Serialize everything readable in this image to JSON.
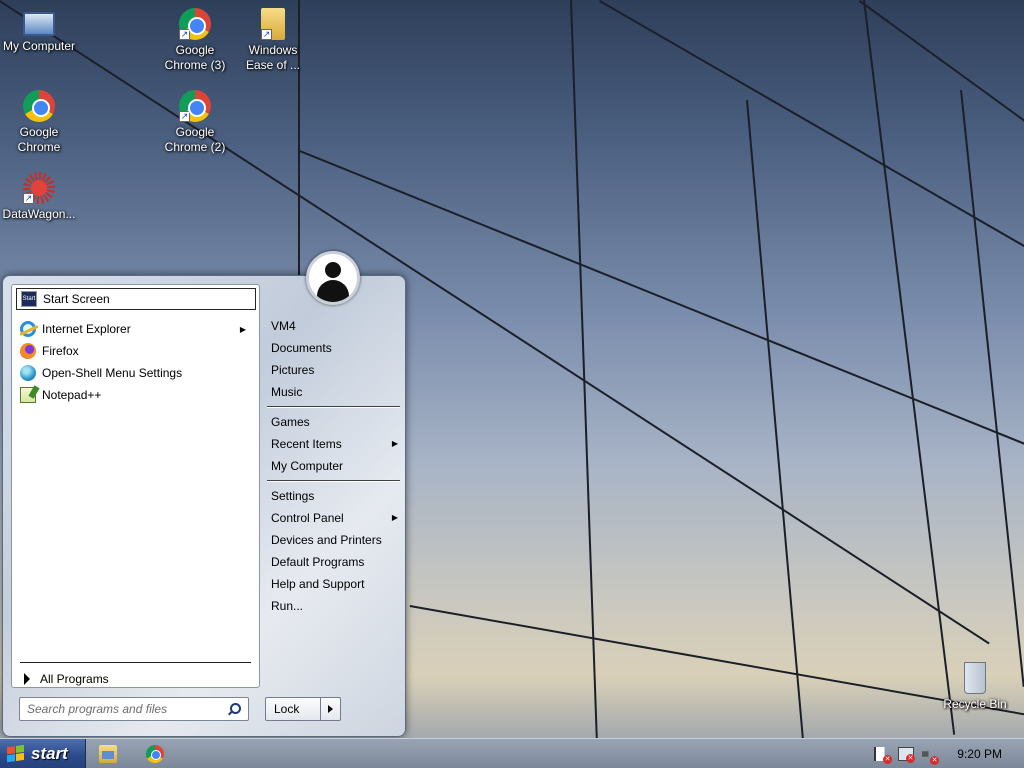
{
  "desktop": {
    "icons": [
      {
        "label_line1": "My Computer",
        "label_line2": "",
        "icon": "computer-icon"
      },
      {
        "label_line1": "Google",
        "label_line2": "Chrome (3)",
        "icon": "chrome-icon"
      },
      {
        "label_line1": "Windows",
        "label_line2": "Ease of ...",
        "icon": "folder-icon"
      },
      {
        "label_line1": "Google",
        "label_line2": "Chrome",
        "icon": "chrome-icon"
      },
      {
        "label_line1": "Google",
        "label_line2": "Chrome (2)",
        "icon": "chrome-icon"
      },
      {
        "label_line1": "DataWagon...",
        "label_line2": "",
        "icon": "datawagon-icon"
      },
      {
        "label_line1": "Recycle Bin",
        "label_line2": "",
        "icon": "recycle-bin-icon"
      }
    ]
  },
  "start_menu": {
    "programs": [
      {
        "label": "Start Screen",
        "icon": "start-screen-icon",
        "has_submenu": false,
        "selected": true
      },
      {
        "label": "Internet Explorer",
        "icon": "internet-explorer-icon",
        "has_submenu": true,
        "selected": false
      },
      {
        "label": "Firefox",
        "icon": "firefox-icon",
        "has_submenu": false,
        "selected": false
      },
      {
        "label": "Open-Shell Menu Settings",
        "icon": "open-shell-icon",
        "has_submenu": false,
        "selected": false
      },
      {
        "label": "Notepad++",
        "icon": "notepad-plus-plus-icon",
        "has_submenu": false,
        "selected": false
      }
    ],
    "start_screen_icon_text": "Start",
    "all_programs": "All Programs",
    "search_placeholder": "Search programs and files",
    "right_items": [
      {
        "label": "VM4",
        "has_submenu": false
      },
      {
        "label": "Documents",
        "has_submenu": false
      },
      {
        "label": "Pictures",
        "has_submenu": false
      },
      {
        "label": "Music",
        "has_submenu": false
      },
      {
        "label": "Games",
        "has_submenu": false
      },
      {
        "label": "Recent Items",
        "has_submenu": true
      },
      {
        "label": "My Computer",
        "has_submenu": false
      },
      {
        "label": "Settings",
        "has_submenu": false
      },
      {
        "label": "Control Panel",
        "has_submenu": true
      },
      {
        "label": "Devices and Printers",
        "has_submenu": false
      },
      {
        "label": "Default Programs",
        "has_submenu": false
      },
      {
        "label": "Help and Support",
        "has_submenu": false
      },
      {
        "label": "Run...",
        "has_submenu": false
      }
    ],
    "lock_label": "Lock",
    "submenu_arrow": "▶"
  },
  "taskbar": {
    "start_label": "start",
    "pinned": [
      {
        "name": "file-explorer-icon"
      },
      {
        "name": "chrome-icon"
      }
    ],
    "tray": [
      "action-center-flag-icon",
      "network-icon",
      "volume-icon"
    ],
    "tray_error_mark": "✕",
    "clock": "9:20 PM"
  },
  "colors": {
    "start_button": "#2c4b8a",
    "menu_background": "#d3dbe6",
    "taskbar": "#8b97a7"
  }
}
